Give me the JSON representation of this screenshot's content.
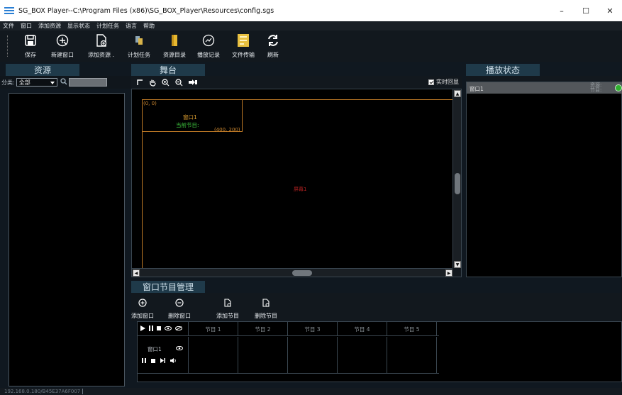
{
  "window": {
    "title": "SG_BOX Player--C:\\Program Files (x86)\\SG_BOX_Player\\Resources\\config.sgs",
    "minimize": "–",
    "maximize": "☐",
    "close": "✕"
  },
  "menu": [
    "文件",
    "窗口",
    "添加资源",
    "显示状态",
    "计划任务",
    "语言",
    "帮助"
  ],
  "toolbar": {
    "save": "保存",
    "new_window": "新建窗口",
    "add_resource": "添加资源 .",
    "plan_task": "计划任务",
    "resource_dir": "资源目录",
    "play_log": "播放记录",
    "file_transfer": "文件传输",
    "refresh": "刷新"
  },
  "left_panel": {
    "title": "资源",
    "filter_label": "分类:",
    "filter_value": "全部",
    "search_placeholder": ""
  },
  "stage": {
    "title": "舞台",
    "realtime_label": "实时回显",
    "origin": "(0, 0)",
    "window_name": "窗口1",
    "current_program": "当前节目:",
    "window_size": "(400, 200)",
    "screen_label": "屏幕1"
  },
  "right_panel": {
    "title": "播放状态",
    "row_window": "窗口1",
    "row_resource": "资源:",
    "row_program": "节目:"
  },
  "program_mgmt": {
    "title": "窗口节目管理",
    "add_window": "添加窗口",
    "delete_window": "删除窗口",
    "add_program": "添加节目",
    "delete_program": "删除节目",
    "columns": [
      "节目 1",
      "节目 2",
      "节目 3",
      "节目 4",
      "节目 5"
    ],
    "row_window": "窗口1"
  },
  "statusbar": {
    "ip": "192.168.0.180/B45E37A6F007"
  }
}
